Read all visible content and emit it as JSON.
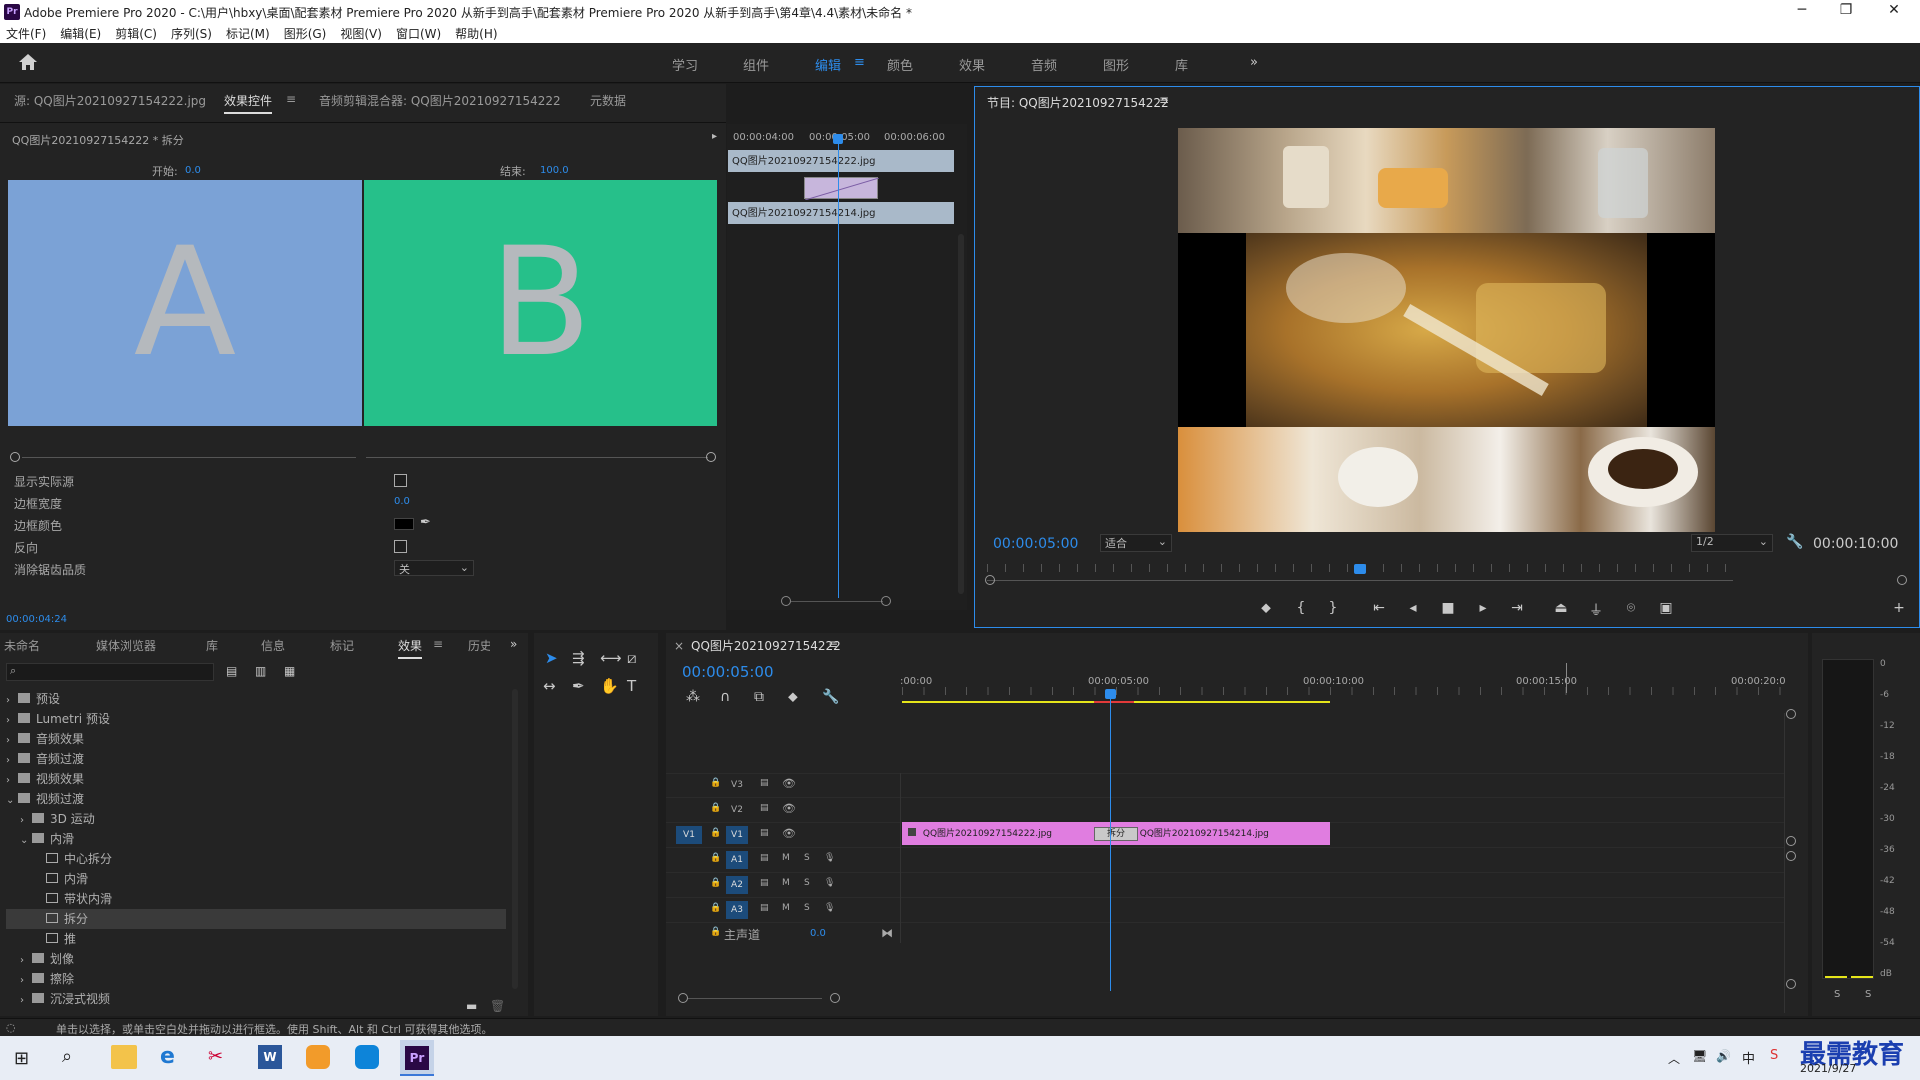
{
  "window": {
    "title": "Adobe Premiere Pro 2020 - C:\\用户\\hbxy\\桌面\\配套素材 Premiere Pro 2020 从新手到高手\\配套素材 Premiere Pro 2020 从新手到高手\\第4章\\4.4\\素材\\未命名 *",
    "app_badge": "Pr",
    "minimize": "─",
    "maximize": "❐",
    "close": "✕"
  },
  "menu": [
    "文件(F)",
    "编辑(E)",
    "剪辑(C)",
    "序列(S)",
    "标记(M)",
    "图形(G)",
    "视图(V)",
    "窗口(W)",
    "帮助(H)"
  ],
  "workspaces": {
    "items": [
      "学习",
      "组件",
      "编辑",
      "颜色",
      "效果",
      "音频",
      "图形",
      "库"
    ],
    "active": "编辑",
    "more": "»",
    "menu_glyph": "≡"
  },
  "effect_controls": {
    "tabs": [
      "源: QQ图片20210927154222.jpg",
      "效果控件",
      "音频剪辑混合器: QQ图片20210927154222",
      "元数据"
    ],
    "active_tab_menu": "≡",
    "clip_label": "QQ图片20210927154222 * 拆分",
    "start_label": "开始:",
    "start_value": "0.0",
    "end_label": "结束:",
    "end_value": "100.0",
    "preview_a": "A",
    "preview_b": "B",
    "params": [
      {
        "label": "显示实际源",
        "type": "checkbox"
      },
      {
        "label": "边框宽度",
        "value": "0.0",
        "type": "value"
      },
      {
        "label": "边框颜色",
        "type": "color"
      },
      {
        "label": "反向",
        "type": "checkbox"
      },
      {
        "label": "消除锯齿品质",
        "value": "关",
        "type": "select"
      }
    ],
    "timecode": "00:00:04:24",
    "mini_timeline": {
      "ticks": [
        "00:00:04:00",
        "00:00:05:00",
        "00:00:06:00"
      ],
      "clip_a": "QQ图片20210927154222.jpg",
      "clip_b": "QQ图片20210927154214.jpg"
    }
  },
  "program": {
    "title": "节目: QQ图片20210927154222",
    "menu_glyph": "≡",
    "timecode": "00:00:05:00",
    "fit": "适合",
    "resolution": "1/2",
    "duration": "00:00:10:00",
    "playhead_fraction": 0.5
  },
  "project": {
    "tabs": [
      "未命名",
      "媒体浏览器",
      "库",
      "信息",
      "标记",
      "效果",
      "历史"
    ],
    "active_tab": "效果",
    "more": "»",
    "search_placeholder": "",
    "tree": [
      {
        "label": "预设",
        "level": 0,
        "expanded": false
      },
      {
        "label": "Lumetri 预设",
        "level": 0,
        "expanded": false
      },
      {
        "label": "音频效果",
        "level": 0,
        "expanded": false
      },
      {
        "label": "音频过渡",
        "level": 0,
        "expanded": false
      },
      {
        "label": "视频效果",
        "level": 0,
        "expanded": false
      },
      {
        "label": "视频过渡",
        "level": 0,
        "expanded": true
      },
      {
        "label": "3D 运动",
        "level": 1,
        "expanded": false
      },
      {
        "label": "内滑",
        "level": 1,
        "expanded": true
      },
      {
        "label": "中心拆分",
        "level": 2
      },
      {
        "label": "内滑",
        "level": 2
      },
      {
        "label": "带状内滑",
        "level": 2
      },
      {
        "label": "拆分",
        "level": 2,
        "selected": true
      },
      {
        "label": "推",
        "level": 2
      },
      {
        "label": "划像",
        "level": 1,
        "expanded": false
      },
      {
        "label": "擦除",
        "level": 1,
        "expanded": false
      },
      {
        "label": "沉浸式视频",
        "level": 1,
        "expanded": false
      }
    ]
  },
  "timeline": {
    "close_glyph": "×",
    "title": "QQ图片20210927154222",
    "menu_glyph": "≡",
    "timecode": "00:00:05:00",
    "ruler": [
      ":00:00",
      "00:00:05:00",
      "00:00:10:00",
      "00:00:15:00",
      "00:00:20:0"
    ],
    "video_tracks": [
      "V3",
      "V2",
      "V1"
    ],
    "audio_tracks": [
      "A1",
      "A2",
      "A3"
    ],
    "source_patch": "V1",
    "master_label": "主声道",
    "master_value": "0.0",
    "m_label": "M",
    "s_label": "S",
    "clip_1": "QQ图片20210927154222.jpg",
    "clip_2": "QQ图片20210927154214.jpg",
    "transition": "拆分"
  },
  "audio_meter": {
    "scale": [
      "0",
      "-6",
      "-12",
      "-18",
      "-24",
      "-30",
      "-36",
      "-42",
      "-48",
      "-54",
      "dB"
    ],
    "solo_left": "S",
    "solo_right": "S"
  },
  "status_bar": "单击以选择，或单击空白处并拖动以进行框选。使用 Shift、Alt 和 Ctrl 可获得其他选项。",
  "taskbar": {
    "date": "2021/9/27",
    "watermark": "最需教育",
    "ime": "中"
  },
  "colors": {
    "accent": "#2d8ceb",
    "clip_pink": "#e07de0",
    "slide_a": "#7ba2d6",
    "slide_b": "#26c08a",
    "work_area": "#e5e51a"
  }
}
